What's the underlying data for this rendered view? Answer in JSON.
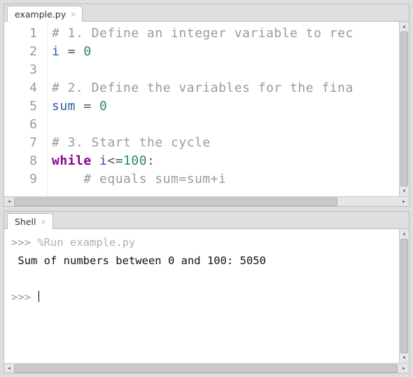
{
  "editor": {
    "tab_title": "example.py",
    "lines": [
      {
        "n": 1,
        "tokens": [
          {
            "cls": "c-comment",
            "t": "# 1. Define an integer variable to rec"
          }
        ]
      },
      {
        "n": 2,
        "tokens": [
          {
            "cls": "c-name",
            "t": "i"
          },
          {
            "cls": "",
            "t": " "
          },
          {
            "cls": "c-op",
            "t": "="
          },
          {
            "cls": "",
            "t": " "
          },
          {
            "cls": "c-num",
            "t": "0"
          }
        ]
      },
      {
        "n": 3,
        "tokens": [
          {
            "cls": "",
            "t": ""
          }
        ]
      },
      {
        "n": 4,
        "tokens": [
          {
            "cls": "c-comment",
            "t": "# 2. Define the variables for the fina"
          }
        ]
      },
      {
        "n": 5,
        "tokens": [
          {
            "cls": "c-name",
            "t": "sum"
          },
          {
            "cls": "",
            "t": " "
          },
          {
            "cls": "c-op",
            "t": "="
          },
          {
            "cls": "",
            "t": " "
          },
          {
            "cls": "c-num",
            "t": "0"
          }
        ]
      },
      {
        "n": 6,
        "tokens": [
          {
            "cls": "",
            "t": ""
          }
        ]
      },
      {
        "n": 7,
        "tokens": [
          {
            "cls": "c-comment",
            "t": "# 3. Start the cycle"
          }
        ]
      },
      {
        "n": 8,
        "tokens": [
          {
            "cls": "c-kw",
            "t": "while"
          },
          {
            "cls": "",
            "t": " "
          },
          {
            "cls": "c-name",
            "t": "i"
          },
          {
            "cls": "c-op",
            "t": "<="
          },
          {
            "cls": "c-num",
            "t": "100"
          },
          {
            "cls": "c-op",
            "t": ":"
          }
        ]
      },
      {
        "n": 9,
        "tokens": [
          {
            "cls": "",
            "t": "    "
          },
          {
            "cls": "c-comment",
            "t": "# equals sum=sum+i"
          }
        ]
      }
    ]
  },
  "shell": {
    "tab_title": "Shell",
    "prompt": ">>>",
    "run_line": "%Run example.py",
    "output_line": " Sum of numbers between 0 and 100: 5050"
  }
}
